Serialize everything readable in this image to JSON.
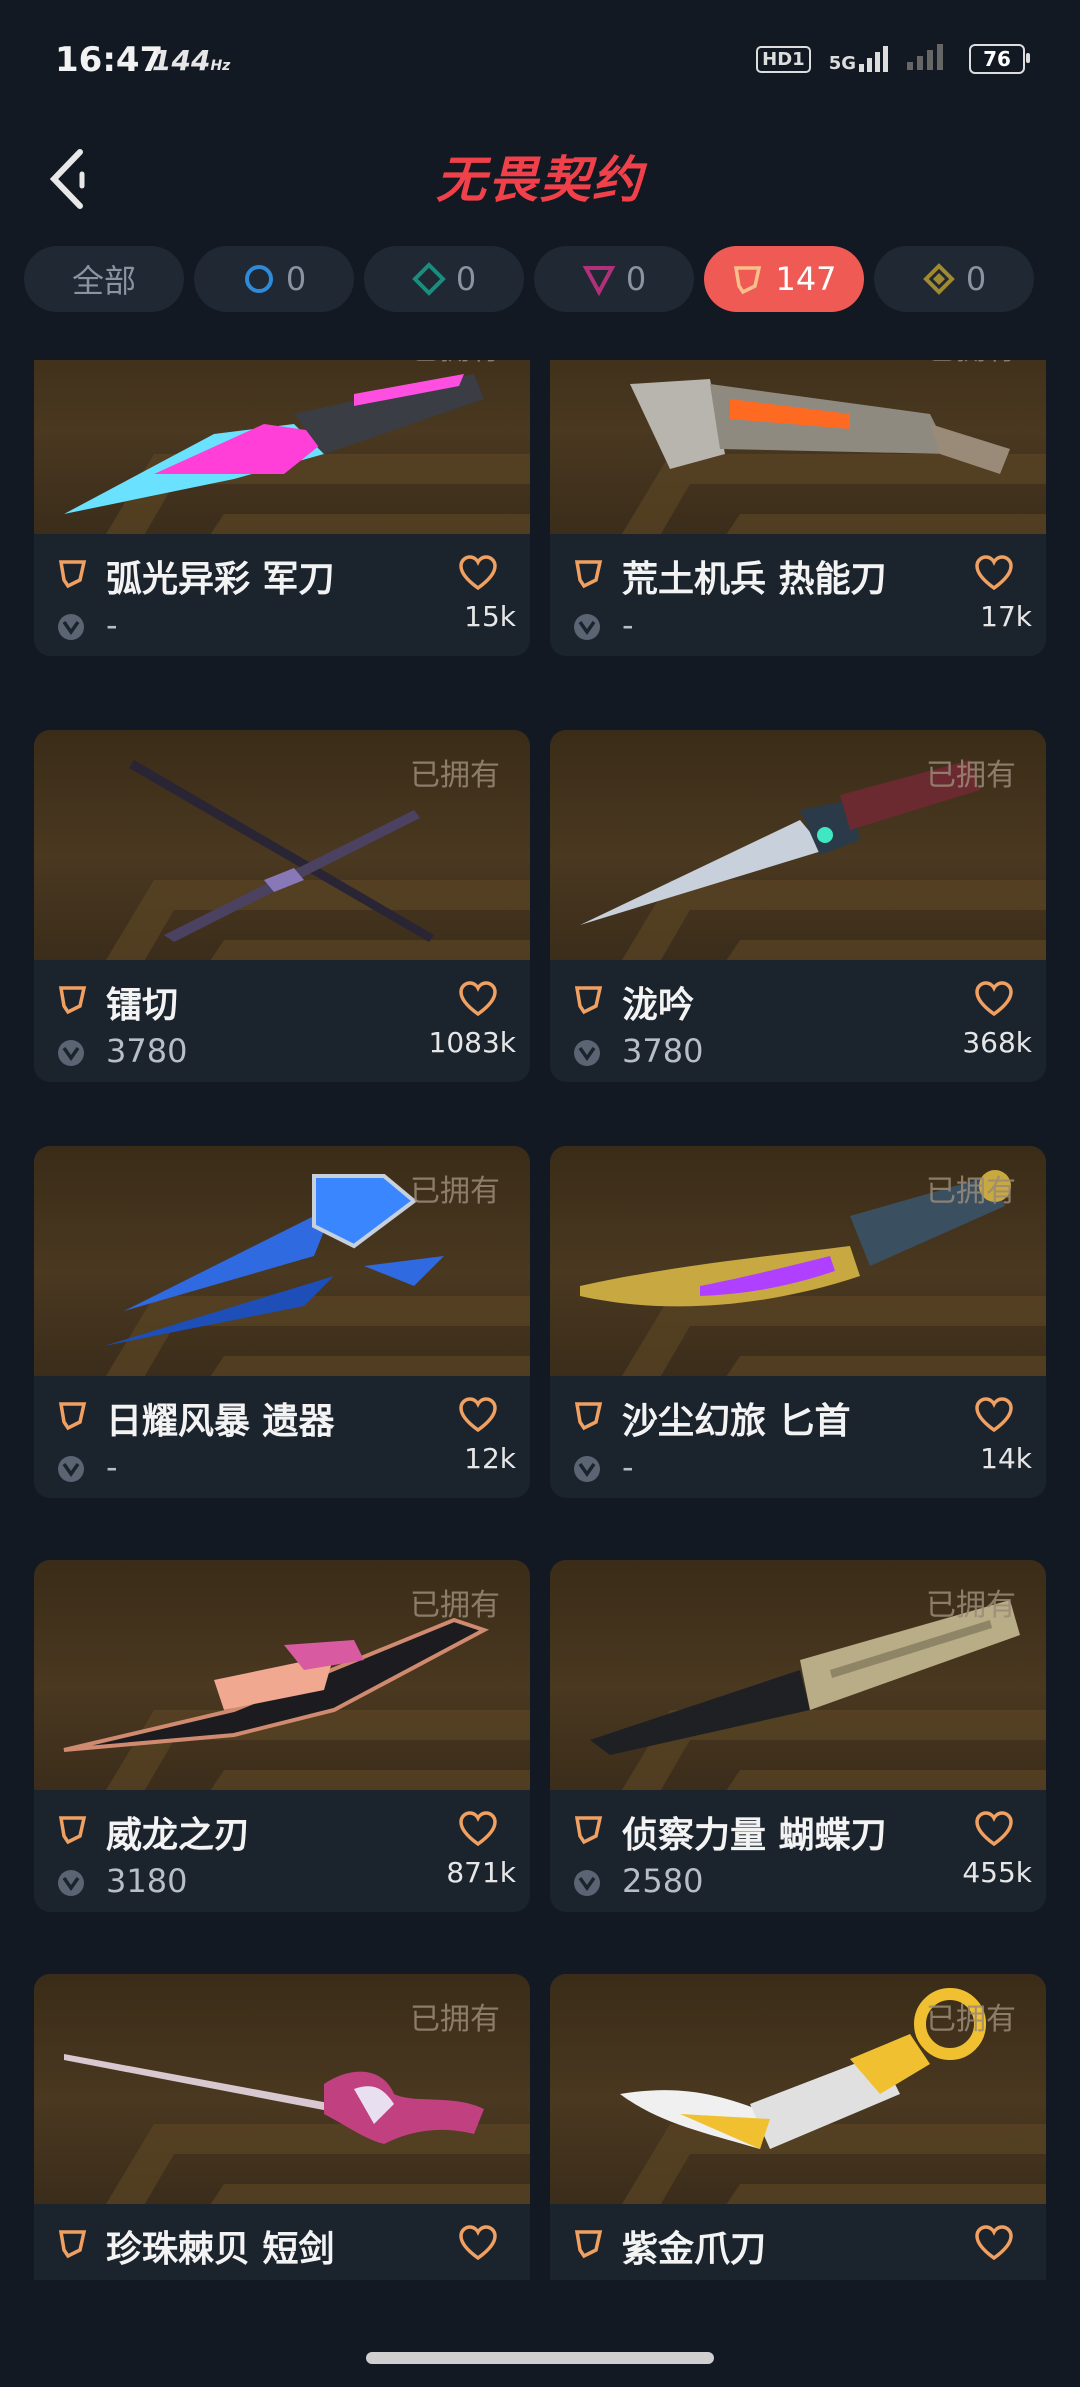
{
  "status_bar": {
    "time": "16:47",
    "refresh_rate": "144",
    "hd_badge": "HD1",
    "network": "5G",
    "battery": "76"
  },
  "header": {
    "title": "无畏契约",
    "back_icon": "back-arrow-icon"
  },
  "filters": [
    {
      "label": "全部",
      "icon": "",
      "color": "#8a93a0",
      "active": false
    },
    {
      "label": "0",
      "icon": "circle-tier-icon",
      "color": "#2f8ad8",
      "active": false
    },
    {
      "label": "0",
      "icon": "diamond-tier-icon",
      "color": "#1a8e7e",
      "active": false
    },
    {
      "label": "0",
      "icon": "triangle-tier-icon",
      "color": "#b0307a",
      "active": false
    },
    {
      "label": "147",
      "icon": "pentagon-tier-icon",
      "color": "#ffffff",
      "active": true
    },
    {
      "label": "0",
      "icon": "gem-tier-icon",
      "color": "#a08a30",
      "active": false
    }
  ],
  "colors": {
    "accent": "#f05a55",
    "tier_orange": "#f0a060",
    "heart": "#f0a060"
  },
  "items": [
    {
      "name": "弧光异彩 军刀",
      "price": "-",
      "likes": "15k",
      "owned": "已拥有"
    },
    {
      "name": "荒土机兵 热能刀",
      "price": "-",
      "likes": "17k",
      "owned": "已拥有"
    },
    {
      "name": "镭切",
      "price": "3780",
      "likes": "1083k",
      "owned": "已拥有"
    },
    {
      "name": "泷吟",
      "price": "3780",
      "likes": "368k",
      "owned": "已拥有"
    },
    {
      "name": "日耀风暴 遗器",
      "price": "-",
      "likes": "12k",
      "owned": "已拥有"
    },
    {
      "name": "沙尘幻旅 匕首",
      "price": "-",
      "likes": "14k",
      "owned": "已拥有"
    },
    {
      "name": "威龙之刃",
      "price": "3180",
      "likes": "871k",
      "owned": "已拥有"
    },
    {
      "name": "侦察力量 蝴蝶刀",
      "price": "2580",
      "likes": "455k",
      "owned": "已拥有"
    },
    {
      "name": "珍珠棘贝 短剑",
      "price": "",
      "likes": "",
      "owned": "已拥有"
    },
    {
      "name": "紫金爪刀",
      "price": "",
      "likes": "",
      "owned": "已拥有"
    }
  ]
}
